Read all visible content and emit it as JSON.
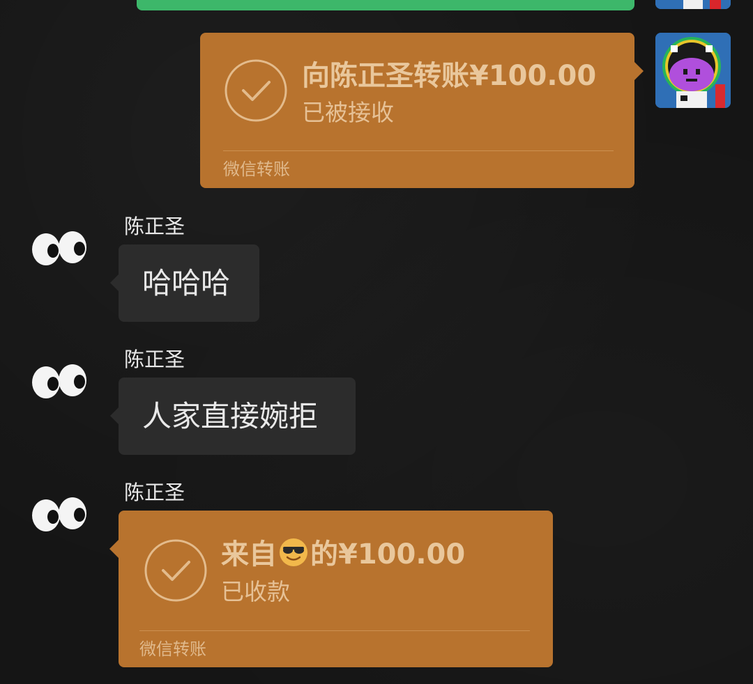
{
  "colors": {
    "background": "#151515",
    "self_bubble_green": "#3db76a",
    "transfer_bubble": "#b8732e",
    "text_bubble": "#2c2c2c",
    "transfer_text": "#e9c79c"
  },
  "messages": {
    "transfer_sent": {
      "amount_text": "向陈正圣转账¥100.00",
      "status": "已被接收",
      "footer": "微信转账",
      "icon": "check-circle-icon"
    },
    "msg1": {
      "sender": "陈正圣",
      "text": "哈哈哈"
    },
    "msg2": {
      "sender": "陈正圣",
      "text": "人家直接婉拒"
    },
    "transfer_received": {
      "sender": "陈正圣",
      "prefix": "来自",
      "emoji": "smiling-face-with-sunglasses",
      "suffix": "的¥100.00",
      "status": "已收款",
      "footer": "微信转账",
      "icon": "check-circle-icon"
    }
  },
  "avatars": {
    "self": "pixel-astronaut-avatar",
    "friend": "googly-eyes-avatar"
  }
}
